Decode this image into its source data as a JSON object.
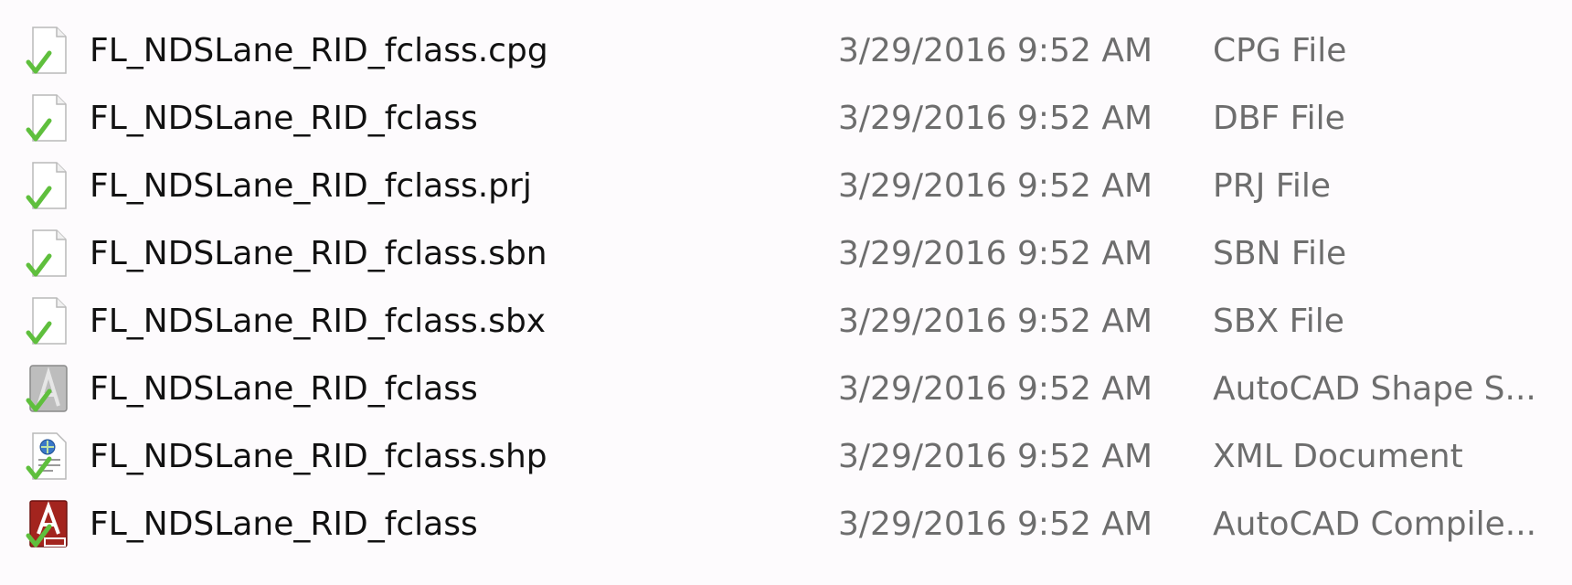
{
  "files": [
    {
      "name": "FL_NDSLane_RID_fclass.cpg",
      "date_modified": "3/29/2016 9:52 AM",
      "type": "CPG File",
      "icon": "generic-file-icon"
    },
    {
      "name": "FL_NDSLane_RID_fclass",
      "date_modified": "3/29/2016 9:52 AM",
      "type": "DBF File",
      "icon": "generic-file-icon"
    },
    {
      "name": "FL_NDSLane_RID_fclass.prj",
      "date_modified": "3/29/2016 9:52 AM",
      "type": "PRJ File",
      "icon": "generic-file-icon"
    },
    {
      "name": "FL_NDSLane_RID_fclass.sbn",
      "date_modified": "3/29/2016 9:52 AM",
      "type": "SBN File",
      "icon": "generic-file-icon"
    },
    {
      "name": "FL_NDSLane_RID_fclass.sbx",
      "date_modified": "3/29/2016 9:52 AM",
      "type": "SBX File",
      "icon": "generic-file-icon"
    },
    {
      "name": "FL_NDSLane_RID_fclass",
      "date_modified": "3/29/2016 9:52 AM",
      "type": "AutoCAD Shape S...",
      "icon": "autocad-shape-icon"
    },
    {
      "name": "FL_NDSLane_RID_fclass.shp",
      "date_modified": "3/29/2016 9:52 AM",
      "type": "XML Document",
      "icon": "xml-document-icon"
    },
    {
      "name": "FL_NDSLane_RID_fclass",
      "date_modified": "3/29/2016 9:52 AM",
      "type": "AutoCAD Compile...",
      "icon": "autocad-compiled-icon"
    }
  ],
  "colors": {
    "background": "#fdfbfd",
    "name_text": "#111111",
    "meta_text": "#6d6d6d",
    "sync_check": "#5fbf3d"
  }
}
